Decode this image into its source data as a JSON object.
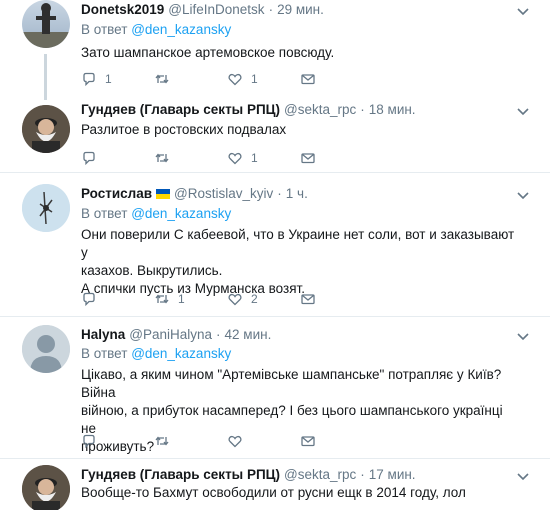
{
  "tweets": [
    {
      "name": "Donetsk2019",
      "handle": "@LifeInDonetsk",
      "dot": "·",
      "time": "29 мин.",
      "reply_prefix": "В ответ",
      "reply_to": "@den_kazansky",
      "text": "Зато шампанское артемовское повсюду.",
      "replies": "1",
      "retweets": "",
      "likes": "1"
    },
    {
      "name": "Гундяев (Главарь секты РПЦ)",
      "handle": "@sekta_rpc",
      "dot": "·",
      "time": "18 мин.",
      "text": "Разлитое в ростовских подвалах",
      "replies": "",
      "retweets": "",
      "likes": "1"
    },
    {
      "name": "Ростислав",
      "handle": "@Rostislav_kyiv",
      "dot": "·",
      "time": "1 ч.",
      "reply_prefix": "В ответ",
      "reply_to": "@den_kazansky",
      "text": "Они поверили С  кабеевой, что в Украине нет соли, вот и заказывают у\nказахов. Выкрутились.\nА спички пусть из Мурманска возят.",
      "replies": "",
      "retweets": "1",
      "likes": "2"
    },
    {
      "name": "Halyna",
      "handle": "@PaniHalyna",
      "dot": "·",
      "time": "42 мин.",
      "reply_prefix": "В ответ",
      "reply_to": "@den_kazansky",
      "text": "Цікаво, а яким чином \"Артемівське шампанське\" потрапляє у Київ? Війна\nвійною, а прибуток насамперед? І без цього шампанського українці не\nпроживуть?",
      "replies": "",
      "retweets": "",
      "likes": ""
    },
    {
      "name": "Гундяев (Главарь секты РПЦ)",
      "handle": "@sekta_rpc",
      "dot": "·",
      "time": "17 мин.",
      "text": "Вообще-то Бахмут освободили от русни ещк в 2014 году, лол"
    }
  ],
  "colors": {
    "accent": "#1da1f2",
    "muted": "#657786",
    "border": "#e6ecf0",
    "thread": "#ccd6dd"
  }
}
